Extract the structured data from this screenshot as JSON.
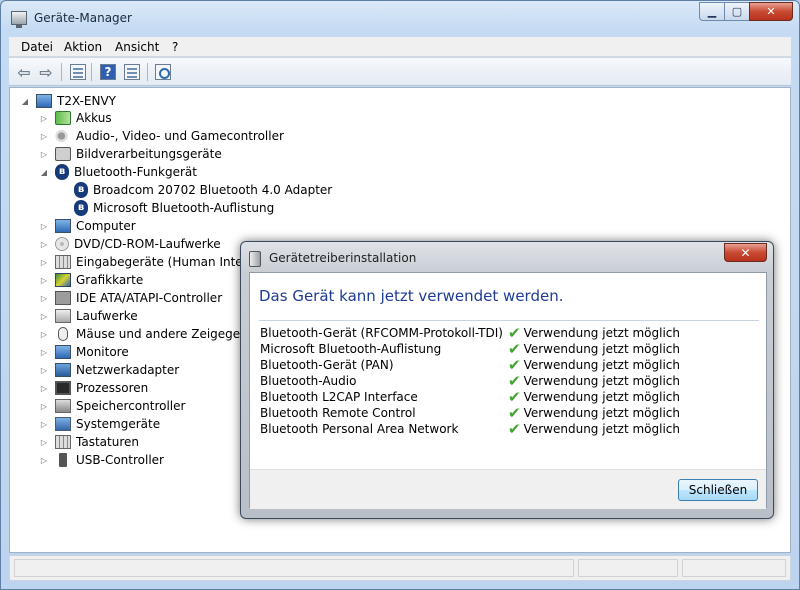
{
  "window": {
    "title": "Geräte-Manager"
  },
  "menu": [
    "Datei",
    "Aktion",
    "Ansicht",
    "?"
  ],
  "tree": {
    "root": "T2X-ENVY",
    "nodes": [
      {
        "label": "Akkus",
        "expanded": false
      },
      {
        "label": "Audio-, Video- und Gamecontroller",
        "expanded": false
      },
      {
        "label": "Bildverarbeitungsgeräte",
        "expanded": false
      },
      {
        "label": "Bluetooth-Funkgerät",
        "expanded": true
      },
      {
        "label": "Broadcom 20702 Bluetooth 4.0 Adapter",
        "child": true
      },
      {
        "label": "Microsoft Bluetooth-Auflistung",
        "child": true
      },
      {
        "label": "Computer",
        "expanded": false
      },
      {
        "label": "DVD/CD-ROM-Laufwerke",
        "expanded": false
      },
      {
        "label": "Eingabegeräte (Human Interface Devices)",
        "expanded": false
      },
      {
        "label": "Grafikkarte",
        "expanded": false
      },
      {
        "label": "IDE ATA/ATAPI-Controller",
        "expanded": false
      },
      {
        "label": "Laufwerke",
        "expanded": false
      },
      {
        "label": "Mäuse und andere Zeigegeräte",
        "expanded": false
      },
      {
        "label": "Monitore",
        "expanded": false
      },
      {
        "label": "Netzwerkadapter",
        "expanded": false
      },
      {
        "label": "Prozessoren",
        "expanded": false
      },
      {
        "label": "Speichercontroller",
        "expanded": false
      },
      {
        "label": "Systemgeräte",
        "expanded": false
      },
      {
        "label": "Tastaturen",
        "expanded": false
      },
      {
        "label": "USB-Controller",
        "expanded": false
      }
    ]
  },
  "dialog": {
    "title": "Gerätetreiberinstallation",
    "close_symbol": "✕",
    "heading": "Das Gerät kann jetzt verwendet werden.",
    "devices": [
      {
        "name": "Bluetooth-Gerät (RFCOMM-Protokoll-TDI)",
        "status": "Verwendung jetzt möglich"
      },
      {
        "name": "Microsoft Bluetooth-Auflistung",
        "status": "Verwendung jetzt möglich"
      },
      {
        "name": "Bluetooth-Gerät (PAN)",
        "status": "Verwendung jetzt möglich"
      },
      {
        "name": "Bluetooth-Audio",
        "status": "Verwendung jetzt möglich"
      },
      {
        "name": "Bluetooth L2CAP Interface",
        "status": "Verwendung jetzt möglich"
      },
      {
        "name": "Bluetooth Remote Control",
        "status": "Verwendung jetzt möglich"
      },
      {
        "name": "Bluetooth Personal Area Network",
        "status": "Verwendung jetzt möglich"
      }
    ],
    "close_button": "Schließen"
  }
}
